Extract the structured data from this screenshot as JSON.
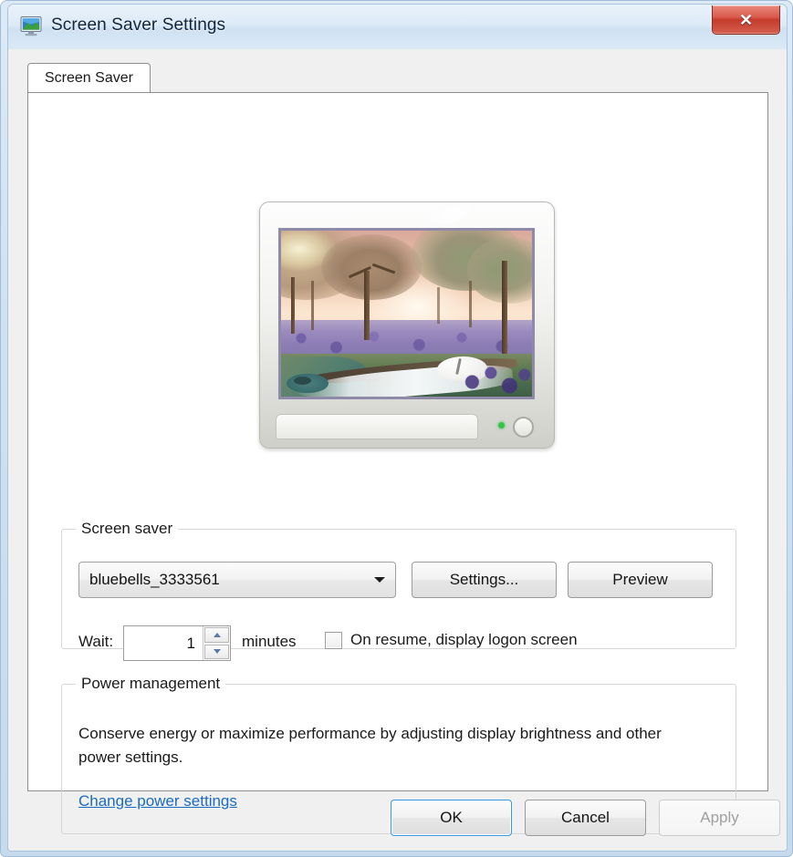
{
  "window": {
    "title": "Screen Saver Settings",
    "icon": "display-monitor-icon",
    "close_label": "✕"
  },
  "tabs": [
    {
      "label": "Screen Saver",
      "selected": true
    }
  ],
  "preview": {
    "monitor_icon": "monitor-preview",
    "screensaver_image_alt": "bluebells woodland painting with blossoming trees and stream",
    "led_color": "#35c44a"
  },
  "screen_saver_group": {
    "label": "Screen saver",
    "combo": {
      "value": "bluebells_3333561",
      "arrow_icon": "chevron-down-icon"
    },
    "settings_button": "Settings...",
    "preview_button": "Preview",
    "wait_label": "Wait:",
    "wait_value": "1",
    "minutes_label": "minutes",
    "on_resume_label": "On resume, display logon screen",
    "on_resume_checked": false
  },
  "power_group": {
    "label": "Power management",
    "description": "Conserve energy or maximize performance by adjusting display brightness and other power settings.",
    "link": "Change power settings",
    "link_color": "#1a6bbf"
  },
  "footer": {
    "ok": "OK",
    "cancel": "Cancel",
    "apply": "Apply",
    "apply_enabled": false,
    "focus_color": "#3399e0"
  }
}
